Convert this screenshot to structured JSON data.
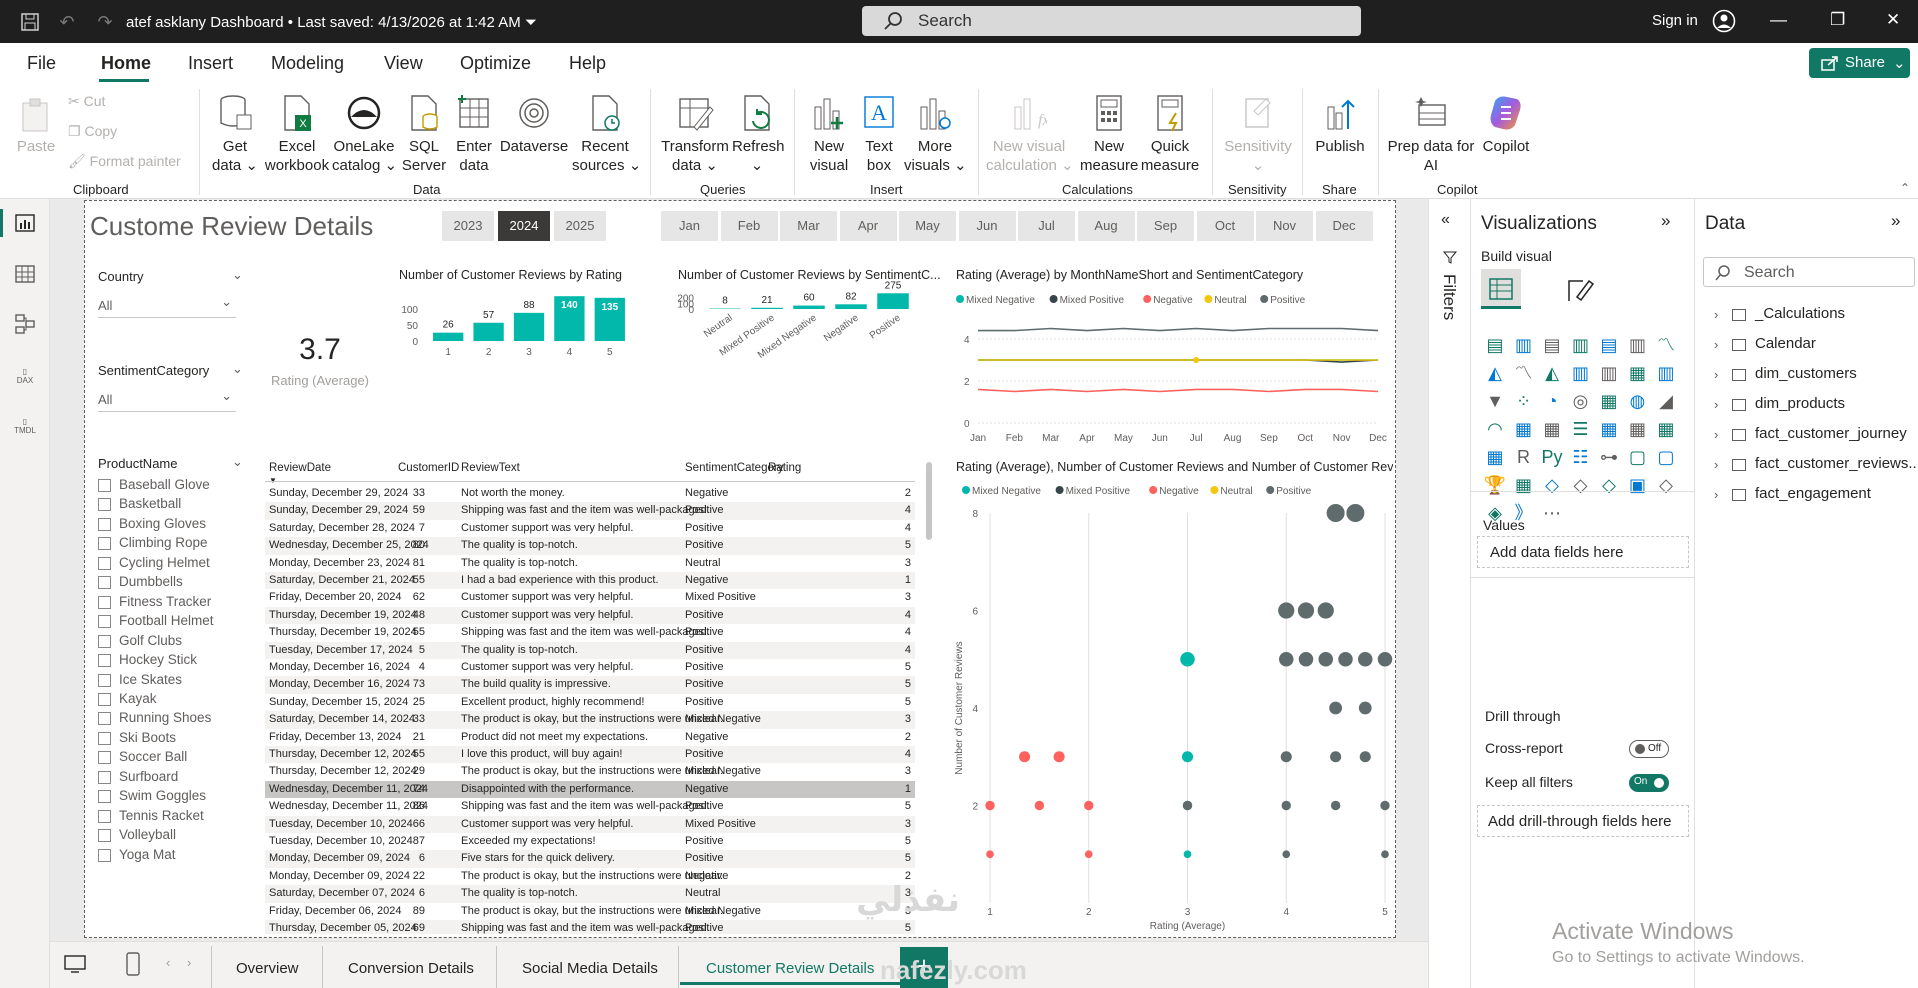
{
  "titlebar": {
    "title": "atef asklany Dashboard",
    "saved": "Last saved: 4/13/2026 at 1:42 AM",
    "search_placeholder": "Search",
    "signin": "Sign in"
  },
  "menu": [
    "File",
    "Home",
    "Insert",
    "Modeling",
    "View",
    "Optimize",
    "Help"
  ],
  "share_label": "Share",
  "ribbon": {
    "clipboard": {
      "paste": "Paste",
      "cut": "Cut",
      "copy": "Copy",
      "format_painter": "Format painter",
      "group": "Clipboard"
    },
    "data": {
      "get_data": "Get\ndata ⌄",
      "excel": "Excel\nworkbook",
      "onelake": "OneLake\ncatalog ⌄",
      "sql": "SQL\nServer",
      "enter": "Enter\ndata",
      "dataverse": "Dataverse",
      "recent": "Recent\nsources ⌄",
      "group": "Data"
    },
    "queries": {
      "transform": "Transform\ndata ⌄",
      "refresh": "Refresh\n⌄",
      "group": "Queries"
    },
    "insert": {
      "new_visual": "New\nvisual",
      "text_box": "Text\nbox",
      "more": "More\nvisuals ⌄",
      "group": "Insert"
    },
    "calculations": {
      "new_visual_calc": "New visual\ncalculation ⌄",
      "new_measure": "New\nmeasure",
      "quick_measure": "Quick\nmeasure",
      "group": "Calculations"
    },
    "sensitivity": {
      "label": "Sensitivity\n⌄",
      "group": "Sensitivity"
    },
    "share": {
      "publish": "Publish",
      "group": "Share"
    },
    "copilot": {
      "prep": "Prep data for\nAI",
      "copilot": "Copilot",
      "group": "Copilot"
    }
  },
  "report": {
    "title": "Custome Review Details",
    "years": [
      "2023",
      "2024",
      "2025"
    ],
    "selected_year": "2024",
    "months": [
      "Jan",
      "Feb",
      "Mar",
      "Apr",
      "May",
      "Jun",
      "Jul",
      "Aug",
      "Sep",
      "Oct",
      "Nov",
      "Dec"
    ],
    "slicers": {
      "country": "Country",
      "country_val": "All",
      "sentiment": "SentimentCategory",
      "sentiment_val": "All",
      "product": "ProductName",
      "products": [
        "Baseball Glove",
        "Basketball",
        "Boxing Gloves",
        "Climbing Rope",
        "Cycling Helmet",
        "Dumbbells",
        "Fitness Tracker",
        "Football Helmet",
        "Golf Clubs",
        "Hockey Stick",
        "Ice Skates",
        "Kayak",
        "Running Shoes",
        "Ski Boots",
        "Soccer Ball",
        "Surfboard",
        "Swim Goggles",
        "Tennis Racket",
        "Volleyball",
        "Yoga Mat"
      ]
    },
    "kpi": {
      "value": "3.7",
      "label": "Rating (Average)"
    },
    "legend": [
      "Mixed Negative",
      "Mixed Positive",
      "Negative",
      "Neutral",
      "Positive"
    ],
    "scatter_title": "Rating (Average), Number of Customer Reviews and Number of Customer Revi...",
    "table_headers": [
      "ReviewDate",
      "CustomerID",
      "ReviewText",
      "SentimentCategory",
      "Rating"
    ],
    "table_rows": [
      [
        "Sunday, December 29, 2024",
        "33",
        "Not worth the money.",
        "Negative",
        "2"
      ],
      [
        "Sunday, December 29, 2024",
        "59",
        "Shipping was fast and the item was well-packaged.",
        "Positive",
        "4"
      ],
      [
        "Saturday, December 28, 2024",
        "7",
        "Customer support was very helpful.",
        "Positive",
        "4"
      ],
      [
        "Wednesday, December 25, 2024",
        "80",
        "The quality is top-notch.",
        "Positive",
        "5"
      ],
      [
        "Monday, December 23, 2024",
        "81",
        "The quality is top-notch.",
        "Neutral",
        "3"
      ],
      [
        "Saturday, December 21, 2024",
        "55",
        "I had a bad experience with this product.",
        "Negative",
        "1"
      ],
      [
        "Friday, December 20, 2024",
        "62",
        "Customer support was very helpful.",
        "Mixed Positive",
        "3"
      ],
      [
        "Thursday, December 19, 2024",
        "48",
        "Customer support was very helpful.",
        "Positive",
        "4"
      ],
      [
        "Thursday, December 19, 2024",
        "55",
        "Shipping was fast and the item was well-packaged.",
        "Positive",
        "4"
      ],
      [
        "Tuesday, December 17, 2024",
        "5",
        "The quality is top-notch.",
        "Positive",
        "4"
      ],
      [
        "Monday, December 16, 2024",
        "4",
        "Customer support was very helpful.",
        "Positive",
        "5"
      ],
      [
        "Monday, December 16, 2024",
        "73",
        "The build quality is impressive.",
        "Positive",
        "5"
      ],
      [
        "Sunday, December 15, 2024",
        "25",
        "Excellent product, highly recommend!",
        "Positive",
        "5"
      ],
      [
        "Saturday, December 14, 2024",
        "33",
        "The product is okay, but the instructions were unclear.",
        "Mixed Negative",
        "3"
      ],
      [
        "Friday, December 13, 2024",
        "21",
        "Product did not meet my expectations.",
        "Negative",
        "2"
      ],
      [
        "Thursday, December 12, 2024",
        "55",
        "I love this product, will buy again!",
        "Positive",
        "4"
      ],
      [
        "Thursday, December 12, 2024",
        "29",
        "The product is okay, but the instructions were unclear.",
        "Mixed Negative",
        "3"
      ],
      [
        "Wednesday, December 11, 2024",
        "74",
        "Disappointed with the performance.",
        "Negative",
        "1"
      ],
      [
        "Wednesday, December 11, 2024",
        "86",
        "Shipping was fast and the item was well-packaged.",
        "Positive",
        "5"
      ],
      [
        "Tuesday, December 10, 2024",
        "66",
        "Customer support was very helpful.",
        "Mixed Positive",
        "3"
      ],
      [
        "Tuesday, December 10, 2024",
        "87",
        "Exceeded my expectations!",
        "Positive",
        "5"
      ],
      [
        "Monday, December 09, 2024",
        "6",
        "Five stars for the quick delivery.",
        "Positive",
        "5"
      ],
      [
        "Monday, December 09, 2024",
        "22",
        "The product is okay, but the instructions were unclear.",
        "Negative",
        "2"
      ],
      [
        "Saturday, December 07, 2024",
        "6",
        "The quality is top-notch.",
        "Neutral",
        "3"
      ],
      [
        "Friday, December 06, 2024",
        "89",
        "The product is okay, but the instructions were unclear.",
        "Mixed Negative",
        "3"
      ],
      [
        "Thursday, December 05, 2024",
        "69",
        "Shipping was fast and the item was well-packaged.",
        "Positive",
        "5"
      ]
    ]
  },
  "chart_data": [
    {
      "type": "bar",
      "title": "Number of Customer Reviews by Rating",
      "categories": [
        "1",
        "2",
        "3",
        "4",
        "5"
      ],
      "values": [
        26,
        57,
        88,
        140,
        135
      ],
      "ylim": [
        0,
        150
      ],
      "yticks": [
        0,
        50,
        100
      ]
    },
    {
      "type": "bar",
      "title": "Number of Customer Reviews by SentimentC...",
      "categories": [
        "Neutral",
        "Mixed Positive",
        "Mixed Negative",
        "Negative",
        "Positive"
      ],
      "values": [
        8,
        21,
        60,
        82,
        275
      ],
      "ylim": [
        0,
        280
      ],
      "yticks": [
        0,
        100,
        200
      ]
    },
    {
      "type": "line",
      "title": "Rating (Average) by MonthNameShort and SentimentCategory",
      "categories": [
        "Jan",
        "Feb",
        "Mar",
        "Apr",
        "May",
        "Jun",
        "Jul",
        "Aug",
        "Sep",
        "Oct",
        "Nov",
        "Dec"
      ],
      "ylim": [
        0,
        5
      ],
      "yticks": [
        0,
        2,
        4
      ],
      "series": [
        {
          "name": "Mixed Negative",
          "values": [
            3,
            3,
            3,
            3,
            3,
            3,
            3,
            3,
            3,
            3,
            3,
            3
          ]
        },
        {
          "name": "Mixed Positive",
          "values": [
            3,
            3,
            3,
            3,
            3,
            3,
            3,
            3,
            3,
            3,
            2.9,
            3
          ]
        },
        {
          "name": "Negative",
          "values": [
            1.6,
            1.5,
            1.6,
            1.5,
            1.6,
            1.5,
            1.6,
            1.6,
            1.5,
            1.6,
            1.6,
            1.5
          ]
        },
        {
          "name": "Neutral",
          "values": [
            3,
            3,
            3,
            3,
            3,
            3,
            3,
            3,
            3,
            3,
            3,
            3
          ]
        },
        {
          "name": "Positive",
          "values": [
            4.4,
            4.4,
            4.5,
            4.4,
            4.5,
            4.4,
            4.5,
            4.4,
            4.5,
            4.5,
            4.5,
            4.4
          ]
        }
      ]
    },
    {
      "type": "scatter",
      "xlabel": "Rating (Average)",
      "ylabel": "Number of Customer Reviews",
      "xlim": [
        1,
        5
      ],
      "ylim": [
        0,
        8
      ],
      "xticks": [
        1,
        2,
        3,
        4,
        5
      ],
      "yticks": [
        2,
        4,
        6,
        8
      ],
      "series": [
        {
          "name": "Negative",
          "points": [
            [
              1,
              1
            ],
            [
              2,
              1
            ],
            [
              1,
              2
            ],
            [
              1.5,
              2
            ],
            [
              2,
              2
            ],
            [
              1.7,
              3
            ],
            [
              1.35,
              3
            ]
          ]
        },
        {
          "name": "Neutral",
          "points": [
            [
              3,
              1
            ],
            [
              3,
              2
            ],
            [
              3,
              3
            ],
            [
              3,
              5
            ]
          ]
        },
        {
          "name": "Mixed Negative",
          "points": [
            [
              3,
              2
            ],
            [
              4,
              1
            ],
            [
              4,
              2
            ],
            [
              4.5,
              2
            ],
            [
              5,
              1
            ],
            [
              5,
              2
            ],
            [
              4,
              3
            ],
            [
              4.5,
              3
            ],
            [
              4.8,
              3
            ],
            [
              4.5,
              4
            ],
            [
              4.8,
              4
            ],
            [
              4,
              5
            ],
            [
              4.2,
              5
            ],
            [
              4.4,
              5
            ],
            [
              4.6,
              5
            ],
            [
              4.8,
              5
            ],
            [
              5,
              5
            ],
            [
              4,
              6
            ],
            [
              4.2,
              6
            ],
            [
              4.4,
              6
            ],
            [
              4.5,
              8
            ],
            [
              4.7,
              8
            ]
          ]
        }
      ]
    }
  ],
  "filters_label": "Filters",
  "viz_pane": {
    "title": "Visualizations",
    "build": "Build visual",
    "values": "Values",
    "add_fields": "Add data fields here",
    "drill": "Drill through",
    "cross": "Cross-report",
    "cross_state": "Off",
    "keep": "Keep all filters",
    "keep_state": "On",
    "add_drill": "Add drill-through fields here"
  },
  "data_pane": {
    "title": "Data",
    "search": "Search",
    "tables": [
      "_Calculations",
      "Calendar",
      "dim_customers",
      "dim_products",
      "fact_customer_journey",
      "fact_customer_reviews...",
      "fact_engagement"
    ]
  },
  "pages": [
    "Overview",
    "Conversion Details",
    "Social Media Details",
    "Customer Review Details"
  ],
  "activate": {
    "line1": "Activate Windows",
    "line2": "Go to Settings to activate Windows."
  },
  "colors": {
    "teal": "#01b8aa",
    "dark": "#374649",
    "red": "#fd625e",
    "yellow": "#f2c80f",
    "grey": "#5f6b6d",
    "accent": "#117865"
  }
}
